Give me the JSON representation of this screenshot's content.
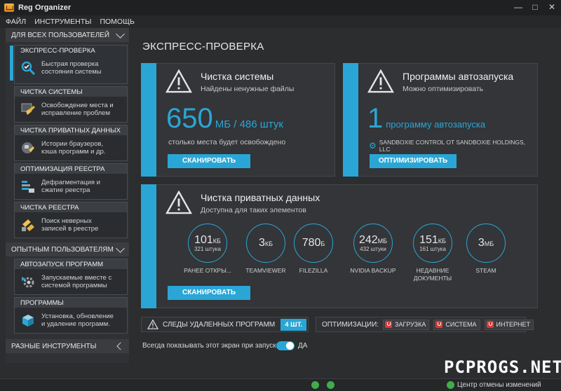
{
  "window": {
    "title": "Reg Organizer"
  },
  "menu": [
    "ФАЙЛ",
    "ИНСТРУМЕНТЫ",
    "ПОМОЩЬ"
  ],
  "sidebar": {
    "section_all": "ДЛЯ ВСЕХ ПОЛЬЗОВАТЕЛЕЙ",
    "section_advanced": "ОПЫТНЫМ ПОЛЬЗОВАТЕЛЯМ",
    "section_misc": "РАЗНЫЕ ИНСТРУМЕНТЫ",
    "items": [
      {
        "title": "ЭКСПРЕСС-ПРОВЕРКА",
        "desc1": "Быстрая проверка",
        "desc2": "состояния системы"
      },
      {
        "title": "ЧИСТКА СИСТЕМЫ",
        "desc1": "Освобождение места и",
        "desc2": "исправление проблем"
      },
      {
        "title": "ЧИСТКА ПРИВАТНЫХ ДАННЫХ",
        "desc1": "Истории браузеров,",
        "desc2": "кэша программ и др."
      },
      {
        "title": "ОПТИМИЗАЦИЯ РЕЕСТРА",
        "desc1": "Дефрагментация и",
        "desc2": "сжатие реестра"
      },
      {
        "title": "ЧИСТКА РЕЕСТРА",
        "desc1": "Поиск неверных",
        "desc2": "записей в реестре"
      },
      {
        "title": "АВТОЗАПУСК ПРОГРАММ",
        "desc1": "Запускаемые вместе с",
        "desc2": "системой программы"
      },
      {
        "title": "ПРОГРАММЫ",
        "desc1": "Установка, обновление",
        "desc2": "и удаление программ."
      }
    ]
  },
  "main": {
    "title": "ЭКСПРЕСС-ПРОВЕРКА",
    "system_clean": {
      "title": "Чистка системы",
      "subtitle": "Найдены ненужные файлы",
      "amount": "650",
      "amount_unit": "МБ / 486 штук",
      "note": "столько места будет освобождено",
      "button": "СКАНИРОВАТЬ"
    },
    "autorun": {
      "title": "Программы автозапуска",
      "subtitle": "Можно оптимизировать",
      "amount": "1",
      "amount_unit": "программу автозапуска",
      "program": "SANDBOXIE CONTROL OT SANDBOXIE HOLDINGS, LLC",
      "button": "ОПТИМИЗИРОВАТЬ"
    },
    "private_data": {
      "title": "Чистка приватных данных",
      "subtitle": "Доступна для таких элементов",
      "button": "СКАНИРОВАТЬ",
      "items": [
        {
          "value": "101",
          "unit": "КБ",
          "count": "321 штука",
          "label1": "РАНЕЕ ОТКРЫ...",
          "label2": ""
        },
        {
          "value": "3",
          "unit": "КБ",
          "count": "",
          "label1": "TEAMVIEWER",
          "label2": ""
        },
        {
          "value": "780",
          "unit": "Б",
          "count": "",
          "label1": "FILEZILLA",
          "label2": ""
        },
        {
          "value": "242",
          "unit": "МБ",
          "count": "432 штуки",
          "label1": "NVIDIA BACKUP",
          "label2": ""
        },
        {
          "value": "151",
          "unit": "КБ",
          "count": "161 штука",
          "label1": "НЕДАВНИЕ",
          "label2": "ДОКУМЕНТЫ"
        },
        {
          "value": "3",
          "unit": "МБ",
          "count": "",
          "label1": "STEAM",
          "label2": ""
        }
      ]
    },
    "traces": {
      "label": "СЛЕДЫ УДАЛЕННЫХ ПРОГРАММ",
      "badge": "4 ШТ."
    },
    "optimizations": {
      "label": "ОПТИМИЗАЦИИ:",
      "chips": [
        "ЗАГРУЗКА",
        "СИСТЕМА",
        "ИНТЕРНЕТ"
      ]
    },
    "startup_toggle": {
      "label": "Всегда показывать этот экран при запуске",
      "state": "ДА"
    }
  },
  "status": {
    "undo_center": "Центр отмены изменений"
  },
  "watermark": "PCPROGS.NET",
  "colors": {
    "accent": "#2aa6d6",
    "bg": "#2b2d2f",
    "warn_chip": "#d23b3b"
  }
}
